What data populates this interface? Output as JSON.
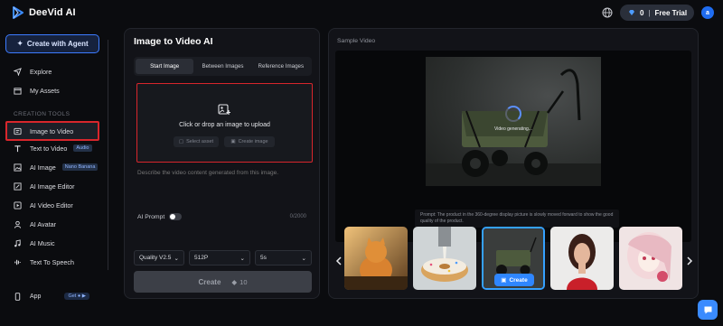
{
  "app": {
    "name": "DeeVid AI"
  },
  "header": {
    "credits": "0",
    "separator": "|",
    "free_trial": "Free Trial",
    "avatar_letter": "a"
  },
  "sidebar": {
    "agent_button": "Create with Agent",
    "items_top": [
      {
        "label": "Explore",
        "icon": "compass-icon"
      },
      {
        "label": "My Assets",
        "icon": "folder-icon"
      }
    ],
    "section_label": "CREATION TOOLS",
    "tools": [
      {
        "label": "Image to Video",
        "icon": "image-video-icon",
        "active": true
      },
      {
        "label": "Text to Video",
        "icon": "text-icon",
        "tag": "Audio"
      },
      {
        "label": "AI Image",
        "icon": "image-icon",
        "tag": "Nano Banana"
      },
      {
        "label": "AI Image Editor",
        "icon": "image-edit-icon"
      },
      {
        "label": "AI Video Editor",
        "icon": "video-edit-icon"
      },
      {
        "label": "AI Avatar",
        "icon": "avatar-icon"
      },
      {
        "label": "AI Music",
        "icon": "music-icon"
      },
      {
        "label": "Text To Speech",
        "icon": "speech-icon"
      }
    ],
    "app": {
      "label": "App",
      "badge": "Get"
    }
  },
  "form": {
    "title": "Image to Video AI",
    "tabs": [
      "Start Image",
      "Between Images",
      "Reference Images"
    ],
    "active_tab": 0,
    "upload_text": "Click or drop an image to upload",
    "select_asset": "Select asset",
    "create_image": "Create image",
    "prompt_placeholder": "Describe the video content generated from this image.",
    "ai_prompt_label": "AI Prompt",
    "ai_prompt_on": false,
    "char_count": "0/2000",
    "quality": "Quality V2.5",
    "resolution": "512P",
    "duration": "5s",
    "create_label": "Create",
    "cost": "10"
  },
  "sample": {
    "label": "Sample Video",
    "status": "Video generating...",
    "prompt_caption": "Prompt:  The product in the 360-degree display picture is slowly moved forward to show the good quality of the product.",
    "thumb_create": "Create",
    "thumbnails": [
      {
        "name": "cat-baker"
      },
      {
        "name": "donut-pour"
      },
      {
        "name": "folding-wagon",
        "selected": true
      },
      {
        "name": "woman-portrait"
      },
      {
        "name": "anime-girl"
      }
    ]
  },
  "colors": {
    "accent": "#2f86ff",
    "highlight": "#d8262c",
    "panel": "#121318"
  }
}
